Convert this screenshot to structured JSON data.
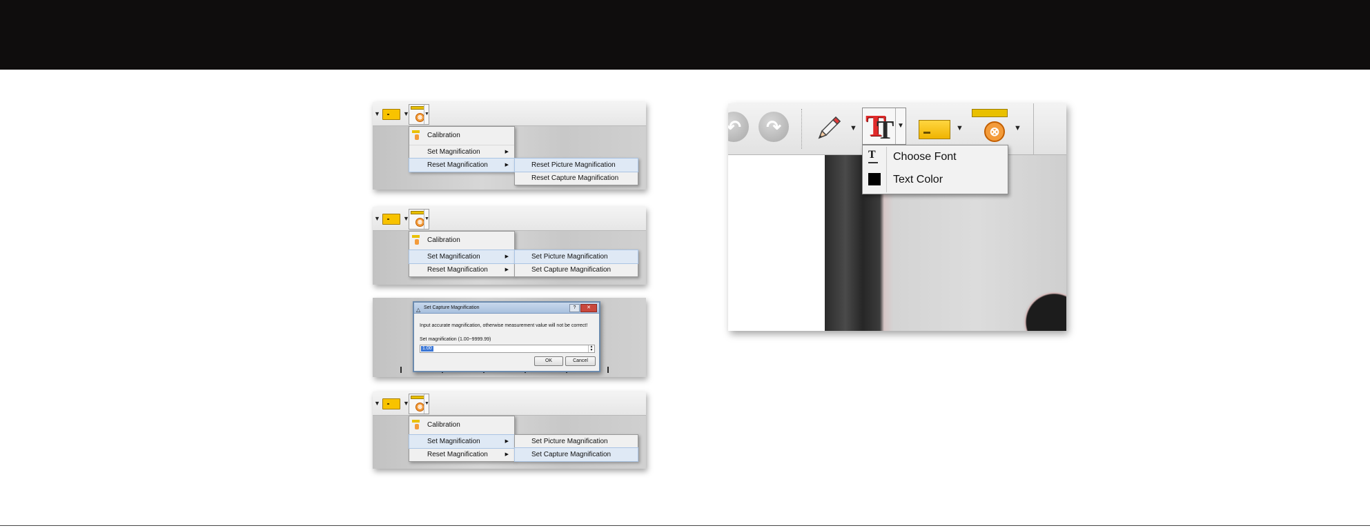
{
  "panel1": {
    "menu": {
      "calibration": "Calibration",
      "set_magnification": "Set Magnification",
      "reset_magnification": "Reset Magnification"
    },
    "submenu": [
      "Reset Picture Magnification",
      "Reset Capture Magnification"
    ],
    "active_menu": "Reset Magnification",
    "active_submenu": "Reset Picture Magnification"
  },
  "panel2": {
    "menu": {
      "calibration": "Calibration",
      "set_magnification": "Set Magnification",
      "reset_magnification": "Reset Magnification"
    },
    "submenu": [
      "Set Picture Magnification",
      "Set Capture Magnification"
    ],
    "active_menu": "Set Magnification",
    "active_submenu": "Set Picture Magnification"
  },
  "dialog": {
    "title": "Set Capture Magnification",
    "message": "Input accurate magnification, otherwise measurement value will not be correct!",
    "field_label": "Set magnification (1.00~9999.99)",
    "value": "1.00",
    "ok": "OK",
    "cancel": "Cancel"
  },
  "panel4": {
    "menu": {
      "calibration": "Calibration",
      "set_magnification": "Set Magnification",
      "reset_magnification": "Reset Magnification"
    },
    "submenu": [
      "Set Picture Magnification",
      "Set Capture Magnification"
    ],
    "active_menu": "Set Magnification",
    "active_submenu": "Set Capture Magnification"
  },
  "text_menu": {
    "choose_font": "Choose Font",
    "text_color": "Text Color",
    "text_color_value": "#000000"
  },
  "icons": {
    "calibration": "ruler-icon",
    "undo": "undo-icon",
    "redo": "redo-icon",
    "pencil": "pencil-icon",
    "text": "text-tool-icon",
    "rectangle": "rectangle-tool-icon",
    "magnification": "magnification-tool-icon",
    "font": "font-icon"
  },
  "colors": {
    "accent_yellow": "#f8c300",
    "accent_orange": "#f39b3a",
    "text_red": "#e12a2a",
    "menu_highlight": "#dfe9f5"
  }
}
